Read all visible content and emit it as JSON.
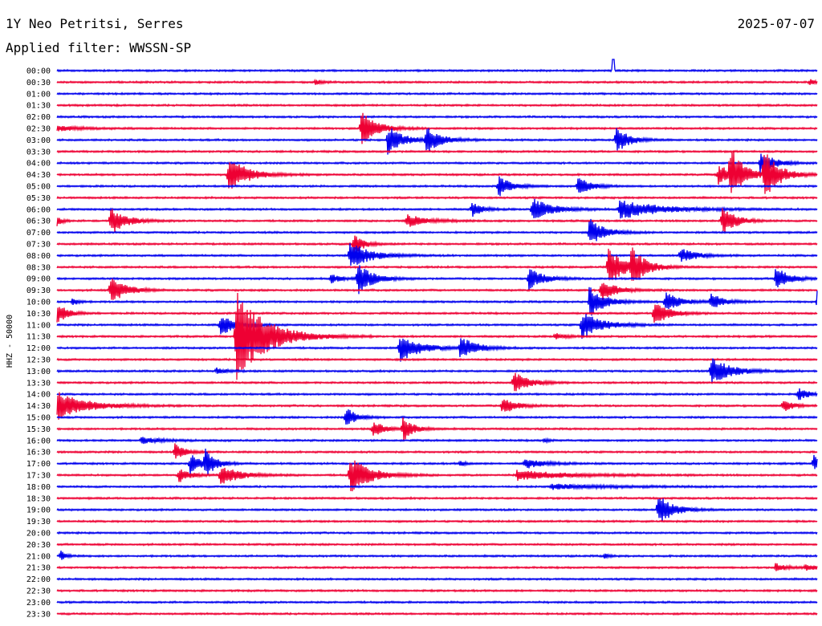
{
  "header": {
    "station": "1Y Neo Petritsi, Serres",
    "date": "2025-07-07",
    "filter": "Applied filter: WWSSN-SP"
  },
  "chart_data": {
    "type": "line",
    "title": "1Y Neo Petritsi, Serres",
    "ylabel": "HHZ - 50000",
    "trace_colors": [
      "#0000ee",
      "#ee0033"
    ],
    "times": [
      "00:00",
      "00:30",
      "01:00",
      "01:30",
      "02:00",
      "02:30",
      "03:00",
      "03:30",
      "04:00",
      "04:30",
      "05:00",
      "05:30",
      "06:00",
      "06:30",
      "07:00",
      "07:30",
      "08:00",
      "08:30",
      "09:00",
      "09:30",
      "10:00",
      "10:30",
      "11:00",
      "11:30",
      "12:00",
      "12:30",
      "13:00",
      "13:30",
      "14:00",
      "14:30",
      "15:00",
      "15:30",
      "16:00",
      "16:30",
      "17:00",
      "17:30",
      "18:00",
      "18:30",
      "19:00",
      "19:30",
      "20:00",
      "20:30",
      "21:00",
      "21:30",
      "22:00",
      "22:30",
      "23:00",
      "23:30"
    ],
    "x_range_minutes": [
      0,
      30
    ],
    "events": [
      {
        "row": 0,
        "t": 0.732,
        "amp": 0,
        "up": 14,
        "dur": 0.01
      },
      {
        "row": 1,
        "t": 0.34,
        "amp": 4,
        "dur": 0.01
      },
      {
        "row": 1,
        "t": 0.99,
        "amp": 4,
        "dur": 0.01
      },
      {
        "row": 5,
        "t": 0.0,
        "amp": 3,
        "dur": 0.05
      },
      {
        "row": 5,
        "t": 0.4,
        "amp": 22,
        "dur": 0.03
      },
      {
        "row": 6,
        "t": 0.435,
        "amp": 18,
        "dur": 0.03
      },
      {
        "row": 6,
        "t": 0.485,
        "amp": 16,
        "dur": 0.03
      },
      {
        "row": 6,
        "t": 0.735,
        "amp": 18,
        "dur": 0.025
      },
      {
        "row": 8,
        "t": 0.925,
        "amp": 14,
        "dur": 0.03
      },
      {
        "row": 9,
        "t": 0.225,
        "amp": 22,
        "dur": 0.04
      },
      {
        "row": 9,
        "t": 0.87,
        "amp": 12,
        "dur": 0.03
      },
      {
        "row": 9,
        "t": 0.885,
        "amp": 36,
        "dur": 0.025
      },
      {
        "row": 9,
        "t": 0.93,
        "amp": 32,
        "dur": 0.03
      },
      {
        "row": 10,
        "t": 0.58,
        "amp": 14,
        "dur": 0.025
      },
      {
        "row": 10,
        "t": 0.685,
        "amp": 12,
        "dur": 0.025
      },
      {
        "row": 12,
        "t": 0.545,
        "amp": 10,
        "dur": 0.02
      },
      {
        "row": 12,
        "t": 0.625,
        "amp": 14,
        "dur": 0.04
      },
      {
        "row": 12,
        "t": 0.74,
        "amp": 12,
        "dur": 0.08
      },
      {
        "row": 13,
        "t": 0.0,
        "amp": 6,
        "dur": 0.01
      },
      {
        "row": 13,
        "t": 0.07,
        "amp": 18,
        "dur": 0.03
      },
      {
        "row": 13,
        "t": 0.46,
        "amp": 8,
        "dur": 0.04
      },
      {
        "row": 13,
        "t": 0.875,
        "amp": 20,
        "dur": 0.025
      },
      {
        "row": 14,
        "t": 0.7,
        "amp": 18,
        "dur": 0.03
      },
      {
        "row": 15,
        "t": 0.39,
        "amp": 14,
        "dur": 0.02
      },
      {
        "row": 16,
        "t": 0.385,
        "amp": 18,
        "dur": 0.04
      },
      {
        "row": 16,
        "t": 0.82,
        "amp": 10,
        "dur": 0.03
      },
      {
        "row": 17,
        "t": 0.725,
        "amp": 26,
        "dur": 0.03
      },
      {
        "row": 17,
        "t": 0.755,
        "amp": 22,
        "dur": 0.03
      },
      {
        "row": 18,
        "t": 0.36,
        "amp": 6,
        "dur": 0.02
      },
      {
        "row": 18,
        "t": 0.395,
        "amp": 20,
        "dur": 0.03
      },
      {
        "row": 18,
        "t": 0.62,
        "amp": 14,
        "dur": 0.03
      },
      {
        "row": 18,
        "t": 0.945,
        "amp": 16,
        "dur": 0.025
      },
      {
        "row": 19,
        "t": 0.07,
        "amp": 18,
        "dur": 0.03
      },
      {
        "row": 19,
        "t": 0.715,
        "amp": 14,
        "dur": 0.03
      },
      {
        "row": 20,
        "t": 0.02,
        "amp": 6,
        "dur": 0.01
      },
      {
        "row": 20,
        "t": 0.7,
        "amp": 20,
        "dur": 0.03
      },
      {
        "row": 20,
        "t": 0.8,
        "amp": 12,
        "dur": 0.03
      },
      {
        "row": 20,
        "t": 0.86,
        "amp": 10,
        "dur": 0.025
      },
      {
        "row": 20,
        "t": 1.0,
        "amp": 14,
        "dur": 0.01
      },
      {
        "row": 21,
        "t": 0.0,
        "amp": 14,
        "dur": 0.02
      },
      {
        "row": 21,
        "t": 0.785,
        "amp": 16,
        "dur": 0.03
      },
      {
        "row": 22,
        "t": 0.215,
        "amp": 14,
        "dur": 0.03
      },
      {
        "row": 22,
        "t": 0.69,
        "amp": 18,
        "dur": 0.04
      },
      {
        "row": 23,
        "t": 0.235,
        "amp": 60,
        "dur": 0.06
      },
      {
        "row": 23,
        "t": 0.655,
        "amp": 4,
        "dur": 0.02
      },
      {
        "row": 24,
        "t": 0.45,
        "amp": 18,
        "dur": 0.04
      },
      {
        "row": 24,
        "t": 0.53,
        "amp": 16,
        "dur": 0.03
      },
      {
        "row": 26,
        "t": 0.21,
        "amp": 4,
        "dur": 0.02
      },
      {
        "row": 26,
        "t": 0.86,
        "amp": 18,
        "dur": 0.04
      },
      {
        "row": 27,
        "t": 0.6,
        "amp": 14,
        "dur": 0.03
      },
      {
        "row": 28,
        "t": 0.975,
        "amp": 8,
        "dur": 0.02
      },
      {
        "row": 29,
        "t": 0.0,
        "amp": 18,
        "dur": 0.06
      },
      {
        "row": 29,
        "t": 0.585,
        "amp": 10,
        "dur": 0.03
      },
      {
        "row": 29,
        "t": 0.955,
        "amp": 8,
        "dur": 0.02
      },
      {
        "row": 30,
        "t": 0.38,
        "amp": 14,
        "dur": 0.02
      },
      {
        "row": 31,
        "t": 0.415,
        "amp": 12,
        "dur": 0.02
      },
      {
        "row": 31,
        "t": 0.455,
        "amp": 16,
        "dur": 0.02
      },
      {
        "row": 32,
        "t": 0.11,
        "amp": 4,
        "dur": 0.04
      },
      {
        "row": 32,
        "t": 0.64,
        "amp": 3,
        "dur": 0.01
      },
      {
        "row": 33,
        "t": 0.155,
        "amp": 10,
        "dur": 0.02
      },
      {
        "row": 34,
        "t": 0.175,
        "amp": 14,
        "dur": 0.02
      },
      {
        "row": 34,
        "t": 0.195,
        "amp": 16,
        "dur": 0.02
      },
      {
        "row": 34,
        "t": 0.53,
        "amp": 4,
        "dur": 0.01
      },
      {
        "row": 34,
        "t": 0.615,
        "amp": 6,
        "dur": 0.04
      },
      {
        "row": 34,
        "t": 0.995,
        "amp": 12,
        "dur": 0.01
      },
      {
        "row": 35,
        "t": 0.16,
        "amp": 10,
        "dur": 0.02
      },
      {
        "row": 35,
        "t": 0.215,
        "amp": 12,
        "dur": 0.04
      },
      {
        "row": 35,
        "t": 0.385,
        "amp": 24,
        "dur": 0.04
      },
      {
        "row": 35,
        "t": 0.605,
        "amp": 6,
        "dur": 0.1
      },
      {
        "row": 36,
        "t": 0.65,
        "amp": 3,
        "dur": 0.12
      },
      {
        "row": 38,
        "t": 0.79,
        "amp": 20,
        "dur": 0.03
      },
      {
        "row": 42,
        "t": 0.005,
        "amp": 6,
        "dur": 0.01
      },
      {
        "row": 42,
        "t": 0.72,
        "amp": 3,
        "dur": 0.01
      },
      {
        "row": 43,
        "t": 0.945,
        "amp": 6,
        "dur": 0.02
      },
      {
        "row": 43,
        "t": 0.985,
        "amp": 4,
        "dur": 0.02
      }
    ]
  }
}
